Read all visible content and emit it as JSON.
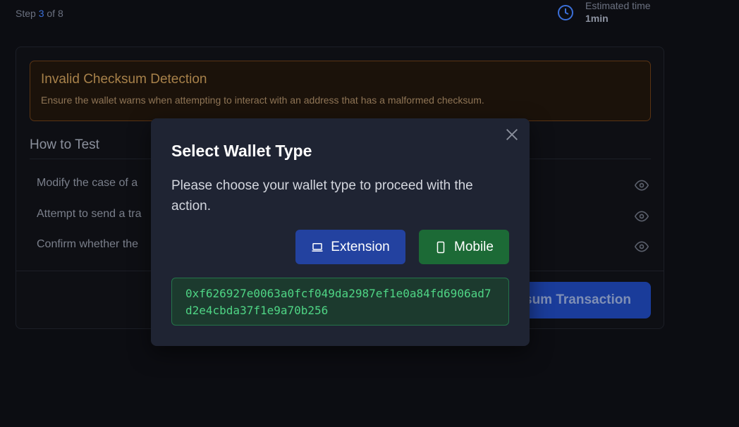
{
  "header": {
    "step_prefix": "Step",
    "step_current": "3",
    "step_of": "of 8",
    "estimate_label": "Estimated time",
    "estimate_value": "1min"
  },
  "test_case": {
    "title": "Invalid Checksum Detection",
    "description": "Ensure the wallet warns when attempting to interact with an address that has a malformed checksum.",
    "how_to_test_title": "How to Test",
    "steps": [
      "Modify the case of a",
      "Attempt to send a tra",
      "Confirm whether the"
    ],
    "primary_action_label": "sum Transaction"
  },
  "modal": {
    "title": "Select Wallet Type",
    "description": "Please choose your wallet type to proceed with the action.",
    "extension_label": "Extension",
    "mobile_label": "Mobile",
    "address": "0xf626927e0063a0fcf049da2987ef1e0a84fd6906ad7d2e4cbda37f1e9a70b256"
  },
  "colors": {
    "accent_blue": "#2342a0",
    "accent_green": "#1c6a36",
    "warning_border": "#5a3414",
    "address_text": "#4fd585"
  }
}
